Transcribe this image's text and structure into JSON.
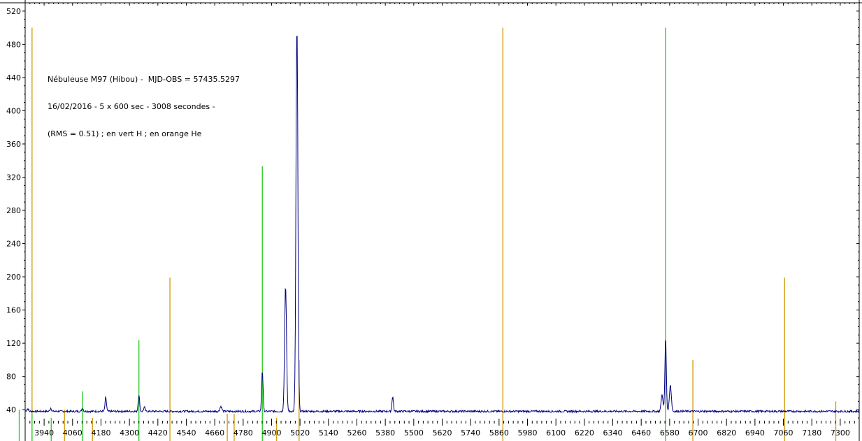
{
  "annotation": {
    "line1": "Nébuleuse M97 (Hibou) -  MJD-OBS = 57435.5297",
    "line2": "16/02/2016 - 5 x 600 sec - 3008 secondes -",
    "line3": "(RMS = 0.51) ; en vert H ; en orange He"
  },
  "chart_data": {
    "type": "line",
    "title": "",
    "xlabel": "",
    "ylabel": "",
    "xlim": [
      3860,
      7380
    ],
    "ylim": [
      25,
      530
    ],
    "grid": false,
    "legend": "none",
    "x_ticks": [
      3940,
      4060,
      4180,
      4300,
      4420,
      4540,
      4660,
      4780,
      4900,
      5020,
      5140,
      5260,
      5380,
      5500,
      5620,
      5740,
      5860,
      5980,
      6100,
      6220,
      6340,
      6460,
      6580,
      6700,
      6820,
      6940,
      7060,
      7180,
      7300
    ],
    "y_ticks": [
      40,
      80,
      120,
      160,
      200,
      240,
      280,
      320,
      360,
      400,
      440,
      480,
      520
    ],
    "colors": {
      "spectrum": "#000080",
      "hydrogen": "#33cc33",
      "helium": "#d4a017"
    },
    "spectrum": {
      "baseline": 38,
      "features": [
        {
          "x": 3870,
          "height": 3,
          "width": 4
        },
        {
          "x": 3968,
          "height": 4,
          "width": 3
        },
        {
          "x": 4102,
          "height": 4,
          "width": 3
        },
        {
          "x": 4200,
          "height": 17,
          "width": 3
        },
        {
          "x": 4340,
          "height": 20,
          "width": 3
        },
        {
          "x": 4363,
          "height": 5,
          "width": 3
        },
        {
          "x": 4686,
          "height": 6,
          "width": 4
        },
        {
          "x": 4861,
          "height": 49,
          "width": 3
        },
        {
          "x": 4959,
          "height": 152,
          "width": 4
        },
        {
          "x": 5007,
          "height": 465,
          "width": 4
        },
        {
          "x": 5411,
          "height": 18,
          "width": 3
        },
        {
          "x": 6548,
          "height": 20,
          "width": 4
        },
        {
          "x": 6563,
          "height": 89,
          "width": 3
        },
        {
          "x": 6583,
          "height": 32,
          "width": 4
        }
      ]
    },
    "hydrogen_lines": [
      {
        "x": 3835,
        "y": 40
      },
      {
        "x": 3889,
        "y": 35
      },
      {
        "x": 3970,
        "y": 30
      },
      {
        "x": 4102,
        "y": 62
      },
      {
        "x": 4340,
        "y": 124
      },
      {
        "x": 4861,
        "y": 333
      },
      {
        "x": 6563,
        "y": 500
      }
    ],
    "helium_lines": [
      {
        "x": 3889,
        "y": 500
      },
      {
        "x": 4026,
        "y": 40
      },
      {
        "x": 4144,
        "y": 30
      },
      {
        "x": 4471,
        "y": 199
      },
      {
        "x": 4713,
        "y": 35
      },
      {
        "x": 4742,
        "y": 35
      },
      {
        "x": 4921,
        "y": 30
      },
      {
        "x": 5016,
        "y": 100
      },
      {
        "x": 5876,
        "y": 500
      },
      {
        "x": 6678,
        "y": 100
      },
      {
        "x": 7065,
        "y": 199
      },
      {
        "x": 7281,
        "y": 50
      }
    ]
  }
}
